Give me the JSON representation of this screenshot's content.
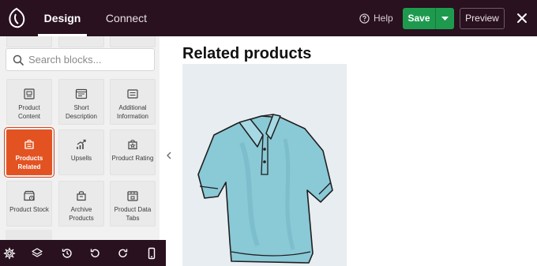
{
  "topbar": {
    "tabs": [
      {
        "label": "Design",
        "active": true
      },
      {
        "label": "Connect",
        "active": false
      }
    ],
    "help_label": "Help",
    "save_label": "Save",
    "preview_label": "Preview"
  },
  "sidebar": {
    "search": {
      "placeholder": "Search blocks..."
    },
    "blocks": [
      {
        "label": "Product Content",
        "icon": "product-content-icon"
      },
      {
        "label": "Short Description",
        "icon": "short-description-icon"
      },
      {
        "label": "Additional Information",
        "icon": "additional-information-icon"
      },
      {
        "label": "Products Related",
        "icon": "products-related-icon",
        "active": true
      },
      {
        "label": "Upsells",
        "icon": "upsells-icon"
      },
      {
        "label": "Product Rating",
        "icon": "product-rating-icon"
      },
      {
        "label": "Product Stock",
        "icon": "product-stock-icon"
      },
      {
        "label": "Archive Products",
        "icon": "archive-products-icon"
      },
      {
        "label": "Product Data Tabs",
        "icon": "product-data-tabs-icon"
      }
    ]
  },
  "toolbar": {
    "buttons": [
      "settings-icon",
      "layers-icon",
      "history-icon",
      "undo-icon",
      "redo-icon",
      "mobile-preview-icon"
    ]
  },
  "canvas": {
    "heading": "Related products",
    "image": "polo-shirt-illustration"
  },
  "colors": {
    "topbar_bg": "#29111f",
    "save_green": "#1e9a4e",
    "active_block": "#e35322"
  }
}
